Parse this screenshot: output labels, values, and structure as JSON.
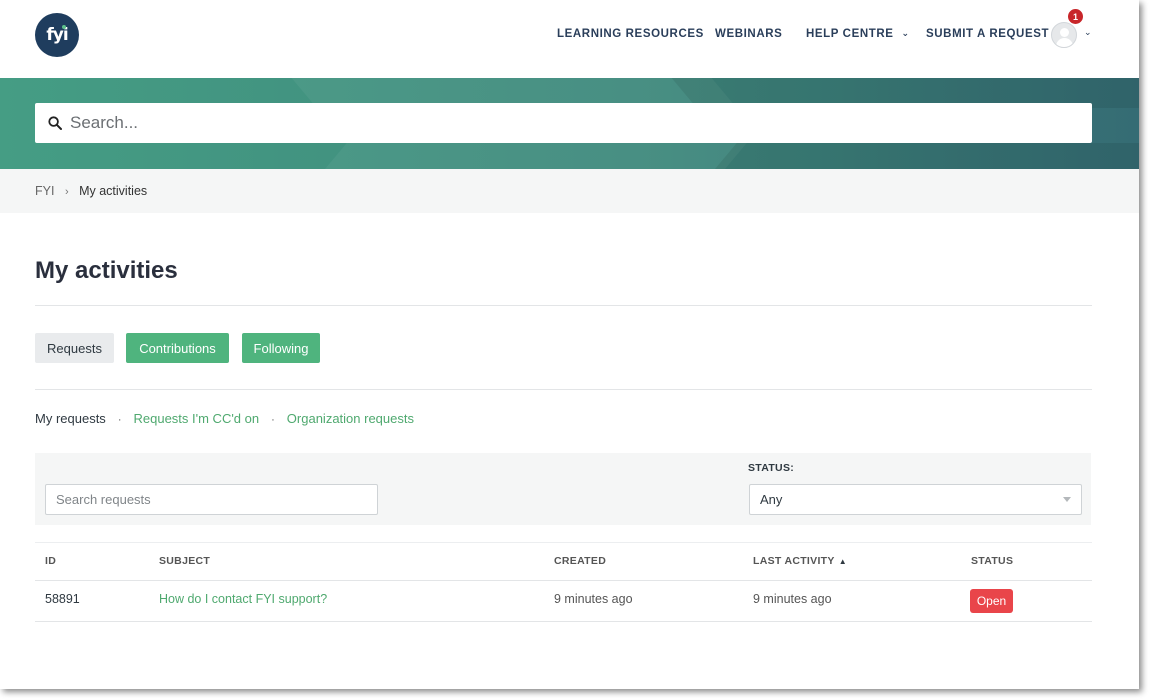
{
  "header": {
    "logo_text": "fyi",
    "nav": [
      {
        "label": "LEARNING RESOURCES"
      },
      {
        "label": "WEBINARS"
      },
      {
        "label": "HELP CENTRE"
      },
      {
        "label": "SUBMIT A REQUEST"
      }
    ],
    "notification_count": "1"
  },
  "hero": {
    "search_placeholder": "Search..."
  },
  "breadcrumb": {
    "root": "FYI",
    "separator": "›",
    "current": "My activities"
  },
  "page": {
    "title": "My activities"
  },
  "tabs": [
    {
      "label": "Requests",
      "active": true
    },
    {
      "label": "Contributions",
      "active": false
    },
    {
      "label": "Following",
      "active": false
    }
  ],
  "subnav": {
    "current": "My requests",
    "links": [
      "Requests I'm CC'd on",
      "Organization requests"
    ]
  },
  "filter": {
    "search_placeholder": "Search requests",
    "status_label": "STATUS:",
    "status_value": "Any"
  },
  "table": {
    "columns": [
      "ID",
      "SUBJECT",
      "CREATED",
      "LAST ACTIVITY",
      "STATUS"
    ],
    "sort_indicator": "▲",
    "rows": [
      {
        "id": "58891",
        "subject": "How do I contact FYI support?",
        "created": "9 minutes ago",
        "last_activity": "9 minutes ago",
        "status": "Open"
      }
    ]
  },
  "colors": {
    "brand_navy": "#1f3d5e",
    "accent_green": "#4fb47e",
    "link_green": "#4fa96f",
    "status_open": "#e9454a",
    "badge_red": "#c8262a"
  }
}
